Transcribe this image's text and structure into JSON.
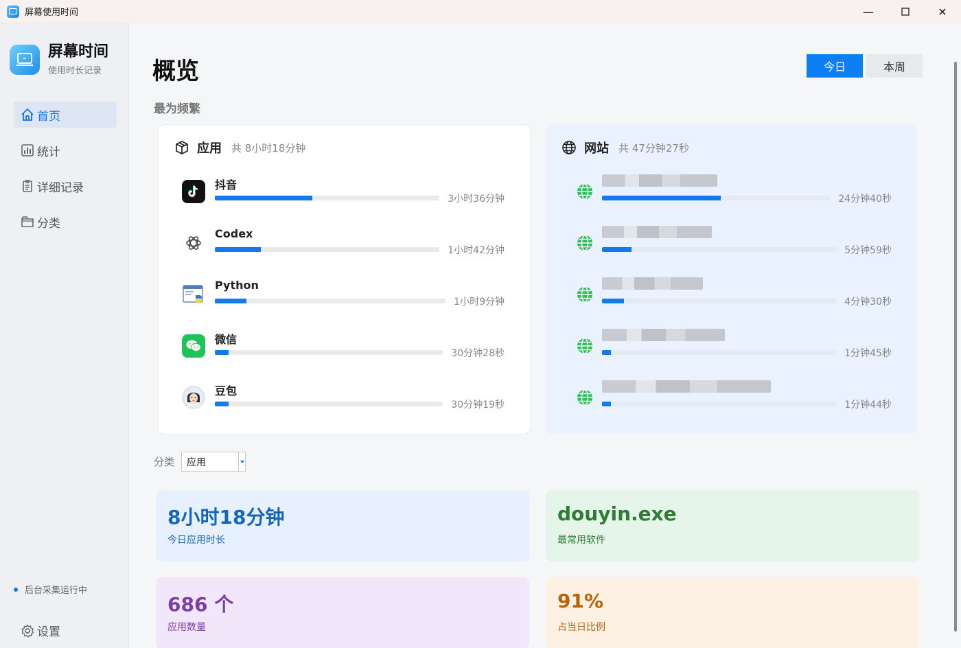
{
  "window": {
    "title": "屏幕使用时间",
    "controls": [
      "minimize-icon",
      "maximize-icon",
      "close-icon"
    ]
  },
  "brand": {
    "title": "屏幕时间",
    "subtitle": "使用时长记录"
  },
  "nav": [
    {
      "label": "首页",
      "icon": "home-icon",
      "active": true
    },
    {
      "label": "统计",
      "icon": "bar-chart-icon",
      "active": false
    },
    {
      "label": "详细记录",
      "icon": "clipboard-icon",
      "active": false
    },
    {
      "label": "分类",
      "icon": "folder-icon",
      "active": false
    }
  ],
  "status": {
    "text": "后台采集运行中",
    "color": "#1a73e8"
  },
  "settings": {
    "label": "设置",
    "icon": "gear-icon"
  },
  "page": {
    "title": "概览",
    "section": "最为频繁"
  },
  "range": {
    "today": "今日",
    "week": "本周",
    "selected": "今日"
  },
  "apps": {
    "title": "应用",
    "total": "共 8小时18分钟",
    "items": [
      {
        "name": "抖音",
        "time": "3小时36分钟",
        "fraction": 0.435,
        "icon": "tiktok-icon"
      },
      {
        "name": "Codex",
        "time": "1小时42分钟",
        "fraction": 0.205,
        "icon": "openai-icon"
      },
      {
        "name": "Python",
        "time": "1小时9分钟",
        "fraction": 0.138,
        "icon": "python-icon"
      },
      {
        "name": "微信",
        "time": "30分钟28秒",
        "fraction": 0.061,
        "icon": "wechat-icon"
      },
      {
        "name": "豆包",
        "time": "30分钟19秒",
        "fraction": 0.061,
        "icon": "doubao-avatar-icon"
      }
    ]
  },
  "sites": {
    "title": "网站",
    "total": "共 47分钟27秒",
    "items": [
      {
        "time": "24分钟40秒",
        "fraction": 0.52,
        "icon": "globe-icon"
      },
      {
        "time": "5分钟59秒",
        "fraction": 0.126,
        "icon": "globe-icon"
      },
      {
        "time": "4分钟30秒",
        "fraction": 0.095,
        "icon": "globe-icon"
      },
      {
        "time": "1分钟45秒",
        "fraction": 0.037,
        "icon": "globe-icon"
      },
      {
        "time": "1分钟44秒",
        "fraction": 0.037,
        "icon": "globe-icon"
      }
    ]
  },
  "filter": {
    "label": "分类",
    "value": "应用"
  },
  "stats": [
    {
      "value": "8小时18分钟",
      "label": "今日应用时长"
    },
    {
      "value": "douyin.exe",
      "label": "最常用软件"
    },
    {
      "value": "686 个",
      "label": "应用数量"
    },
    {
      "value": "91%",
      "label": "占当日比例"
    }
  ]
}
